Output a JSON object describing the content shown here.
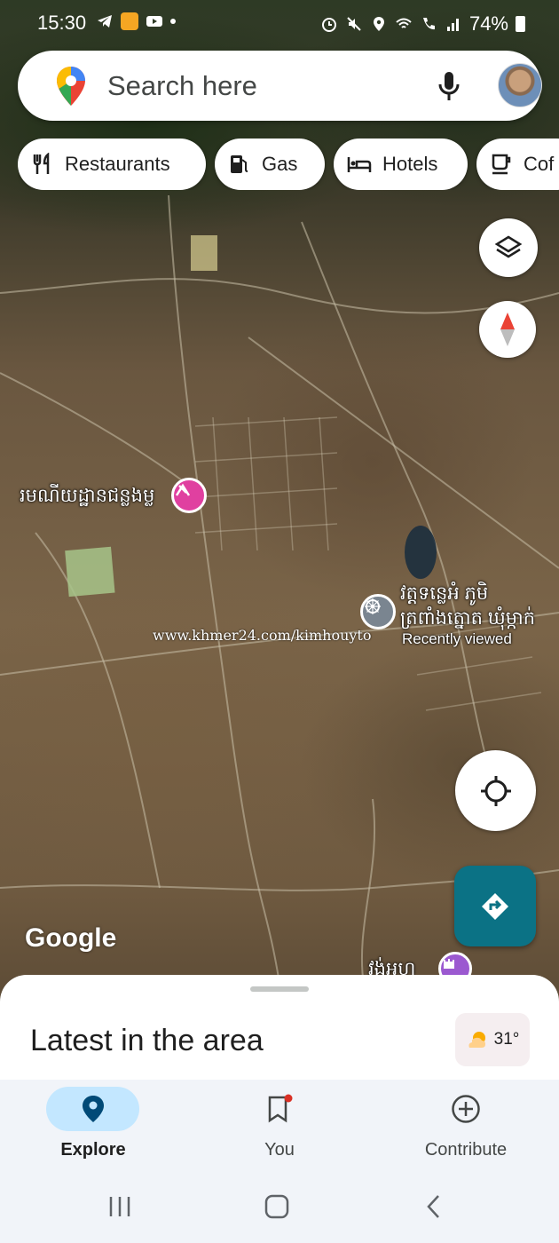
{
  "status_bar": {
    "time": "15:30",
    "battery": "74%"
  },
  "search": {
    "placeholder": "Search here"
  },
  "chips": [
    {
      "label": "Restaurants",
      "icon": "fork-knife-icon"
    },
    {
      "label": "Gas",
      "icon": "gas-pump-icon"
    },
    {
      "label": "Hotels",
      "icon": "bed-icon"
    },
    {
      "label": "Cof",
      "icon": "coffee-cup-icon"
    }
  ],
  "map": {
    "labels": {
      "place1": "រមណីយដ្ឋានជន្លងម្ល",
      "place2_line1": "វត្តទន្លេអំ ភូមិ",
      "place2_line2": "ត្រពាំងត្នោត ឃុំម្កាក់",
      "recently_viewed": "Recently viewed",
      "place3": "វង់អហ"
    },
    "watermark": "www.khmer24.com/kimhouyto",
    "google_logo": "Google"
  },
  "sheet": {
    "title": "Latest in the area",
    "weather": "31°"
  },
  "bottom_nav": [
    {
      "label": "Explore",
      "icon": "location-pin-icon",
      "active": true
    },
    {
      "label": "You",
      "icon": "bookmark-icon",
      "active": false
    },
    {
      "label": "Contribute",
      "icon": "add-circle-icon",
      "active": false
    }
  ],
  "colors": {
    "accent_nav": "#c3e7ff",
    "directions": "#0b7285",
    "poi_pink": "#e040a0"
  }
}
